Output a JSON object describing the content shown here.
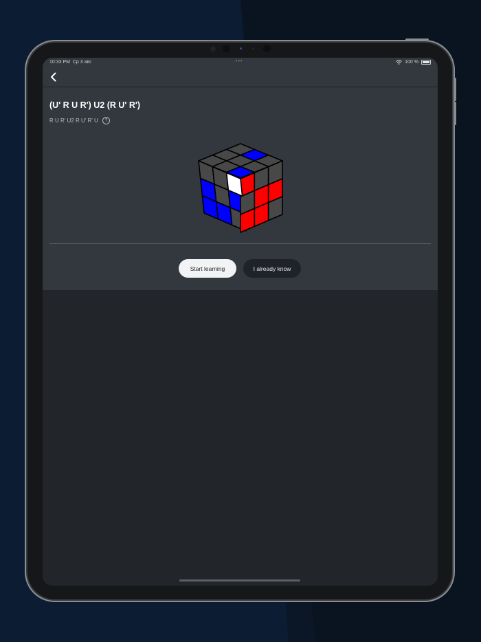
{
  "status_bar": {
    "time": "10:33 PM",
    "date": "Ср 3 авг.",
    "dots": "•••",
    "battery": "100 %"
  },
  "algorithm": {
    "title": "(U' R U R') U2 (R U' R')",
    "notation": "R U R' U2 R U' R' U",
    "help_glyph": "?"
  },
  "actions": {
    "start_label": "Start learning",
    "known_label": "I already know"
  },
  "cube_colors": {
    "gray": "#484848",
    "blue": "#0000ff",
    "white": "#ffffff",
    "red": "#ff0000",
    "edge": "#000000"
  },
  "icons": {
    "back": "chevron-left-icon",
    "help": "question-circle-icon",
    "wifi": "wifi-icon",
    "battery": "battery-icon"
  }
}
